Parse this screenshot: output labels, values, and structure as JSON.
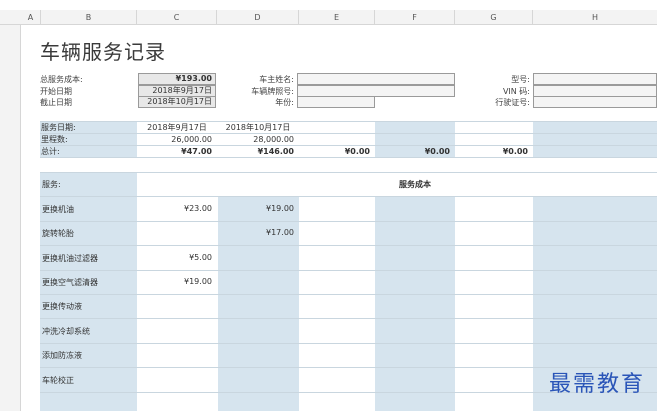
{
  "columns": [
    "A",
    "B",
    "C",
    "D",
    "E",
    "F",
    "G",
    "H"
  ],
  "title": "车辆服务记录",
  "info": {
    "total_cost_label": "总服务成本:",
    "total_cost_value": "¥193.00",
    "start_date_label": "开始日期",
    "start_date_value": "2018年9月17日",
    "end_date_label": "截止日期",
    "end_date_value": "2018年10月17日",
    "owner_label": "车主姓名:",
    "owner_value": "",
    "plate_label": "车辆牌照号:",
    "plate_value": "",
    "year_label": "年份:",
    "year_value": "",
    "model_label": "型号:",
    "model_value": "",
    "vin_label": "VIN 码:",
    "vin_value": "",
    "license_label": "行驶证号:",
    "license_value": ""
  },
  "summary": {
    "date_label": "服务日期:",
    "odometer_label": "里程数:",
    "total_label": "总计:",
    "dates": [
      "2018年9月17日",
      "2018年10月17日",
      "",
      "",
      "",
      ""
    ],
    "odometer": [
      "26,000.00",
      "28,000.00",
      "",
      "",
      "",
      ""
    ],
    "totals": [
      "¥47.00",
      "¥146.00",
      "¥0.00",
      "¥0.00",
      "¥0.00",
      ""
    ]
  },
  "services": {
    "header_label": "服务:",
    "cost_header": "服务成本",
    "rows": [
      {
        "name": "更换机油",
        "c": "¥23.00",
        "d": "¥19.00"
      },
      {
        "name": "旋转轮胎",
        "c": "",
        "d": "¥17.00"
      },
      {
        "name": "更换机油过滤器",
        "c": "¥5.00",
        "d": ""
      },
      {
        "name": "更换空气滤清器",
        "c": "¥19.00",
        "d": ""
      },
      {
        "name": "更换传动液",
        "c": "",
        "d": ""
      },
      {
        "name": "冲洗冷却系统",
        "c": "",
        "d": ""
      },
      {
        "name": "添加防冻液",
        "c": "",
        "d": ""
      },
      {
        "name": "车轮校正",
        "c": "",
        "d": ""
      }
    ]
  },
  "watermark": "最需教育"
}
